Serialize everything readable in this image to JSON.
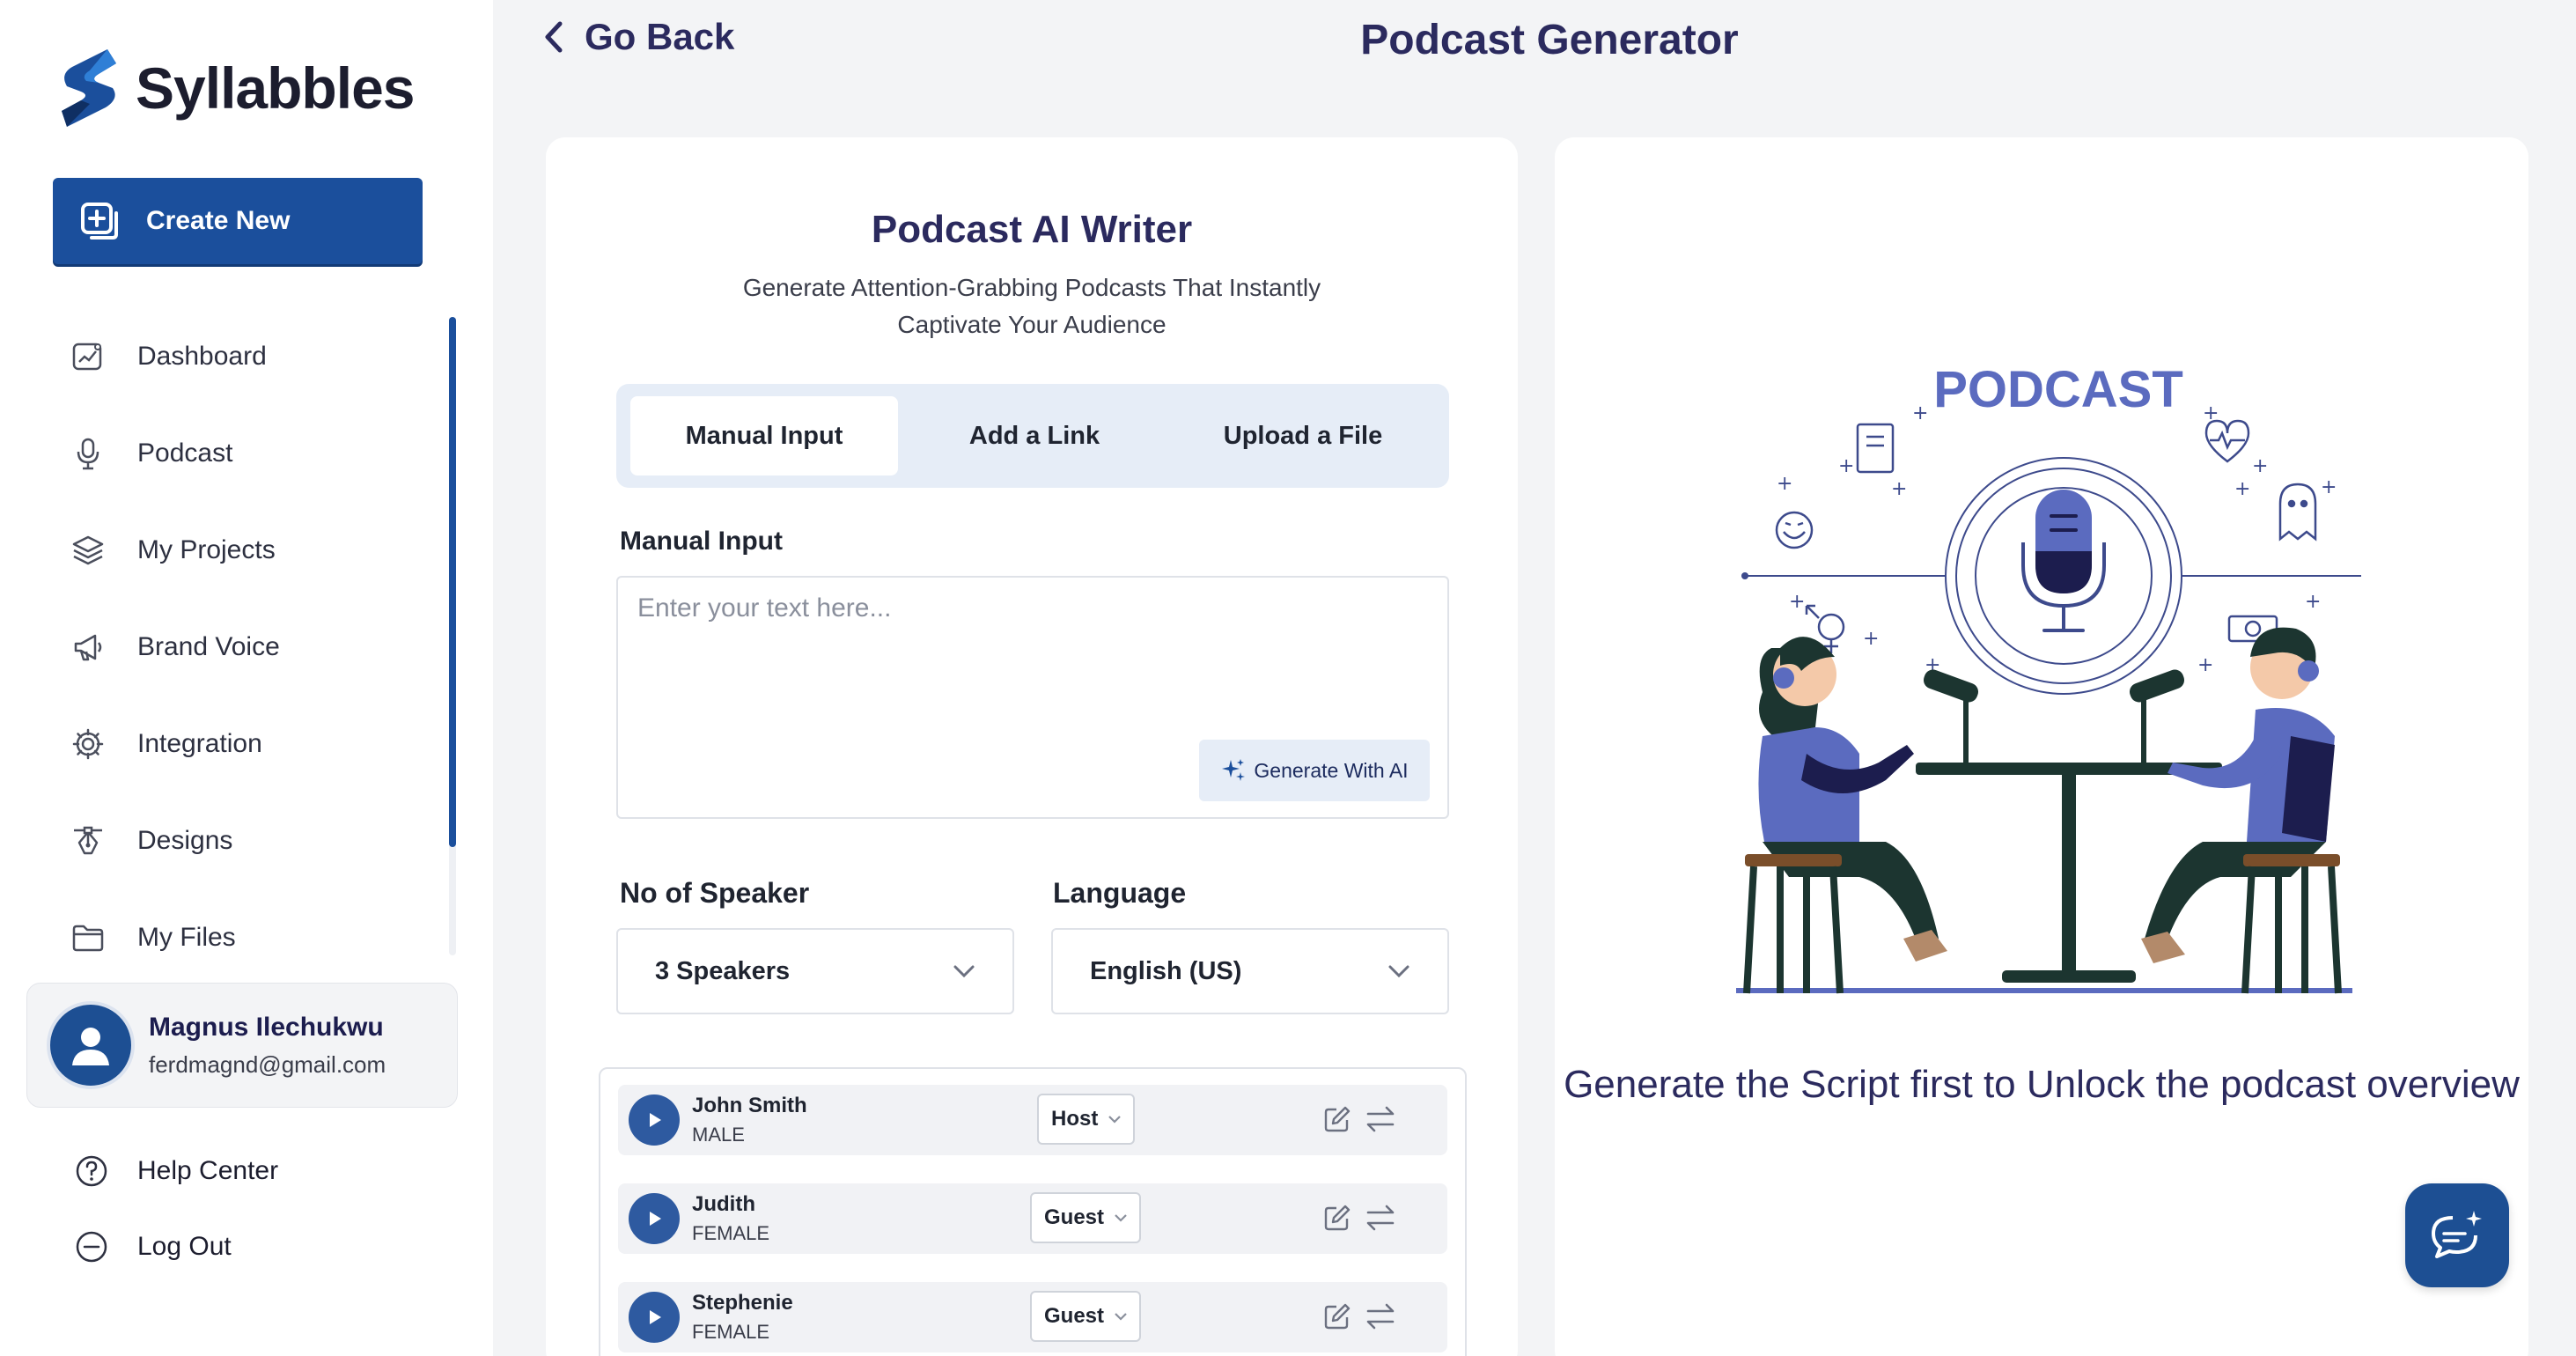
{
  "brand": {
    "name": "Syllabbles"
  },
  "sidebar": {
    "create_label": "Create New",
    "items": [
      {
        "label": "Dashboard",
        "icon": "dashboard-icon"
      },
      {
        "label": "Podcast",
        "icon": "microphone-icon"
      },
      {
        "label": "My Projects",
        "icon": "layers-icon"
      },
      {
        "label": "Brand Voice",
        "icon": "megaphone-icon"
      },
      {
        "label": "Integration",
        "icon": "gear-icon"
      },
      {
        "label": "Designs",
        "icon": "pen-tool-icon"
      },
      {
        "label": "My Files",
        "icon": "folder-icon"
      }
    ],
    "user": {
      "name": "Magnus Ilechukwu",
      "email": "ferdmagnd@gmail.com"
    },
    "help_label": "Help Center",
    "logout_label": "Log Out"
  },
  "header": {
    "back_label": "Go Back",
    "title": "Podcast Generator"
  },
  "writer": {
    "title": "Podcast AI Writer",
    "subtitle": "Generate Attention-Grabbing Podcasts That Instantly Captivate Your Audience",
    "tabs": [
      "Manual Input",
      "Add a Link",
      "Upload a File"
    ],
    "active_tab": "Manual Input",
    "input_label": "Manual Input",
    "input_placeholder": "Enter your text here...",
    "input_value": "",
    "generate_label": "Generate With AI",
    "speaker_label": "No of Speaker",
    "speaker_value": "3 Speakers",
    "language_label": "Language",
    "language_value": "English (US)",
    "speakers": [
      {
        "name": "John Smith",
        "gender": "MALE",
        "role": "Host"
      },
      {
        "name": "Judith",
        "gender": "FEMALE",
        "role": "Guest"
      },
      {
        "name": "Stephenie",
        "gender": "FEMALE",
        "role": "Guest"
      }
    ]
  },
  "preview": {
    "illustration_title": "PODCAST",
    "message": "Generate the Script first to Unlock the podcast overview"
  },
  "colors": {
    "primary": "#1b4f9c",
    "heading": "#2b2a5e",
    "accent_light": "#e6edf7",
    "illustration": "#5b6bbf"
  }
}
